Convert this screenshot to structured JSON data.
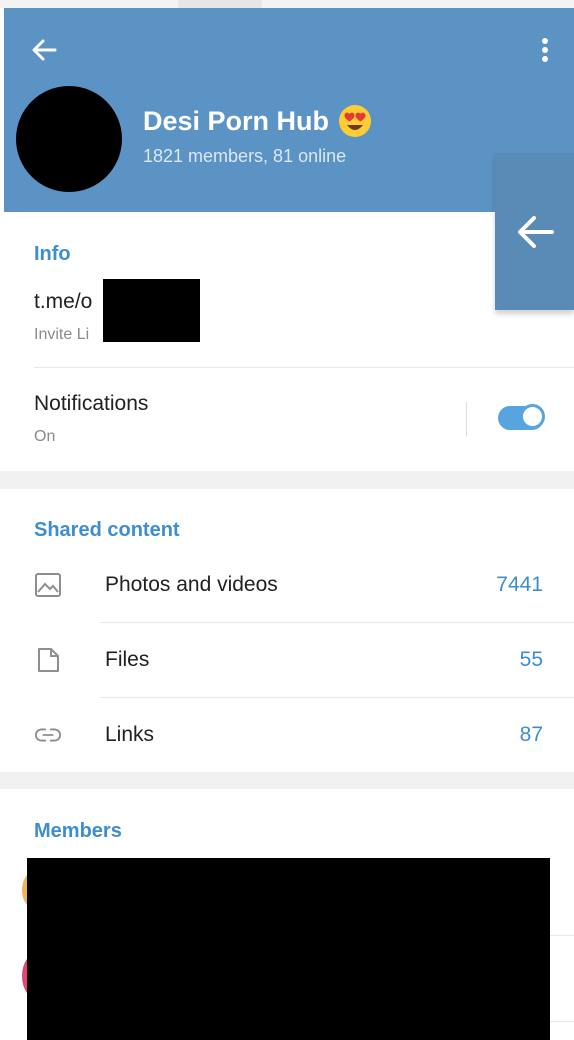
{
  "header": {
    "title": "Desi Porn Hub",
    "subtitle": "1821 members, 81 online"
  },
  "info": {
    "section_title": "Info",
    "link_prefix": "t.me/o",
    "link_label": "Invite Li"
  },
  "notifications": {
    "title": "Notifications",
    "status": "On",
    "enabled": true
  },
  "shared_content": {
    "section_title": "Shared content",
    "items": [
      {
        "label": "Photos and videos",
        "count": "7441",
        "icon": "image-icon"
      },
      {
        "label": "Files",
        "count": "55",
        "icon": "file-icon"
      },
      {
        "label": "Links",
        "count": "87",
        "icon": "link-icon"
      }
    ]
  },
  "members": {
    "section_title": "Members"
  },
  "colors": {
    "header": "#5b93c4",
    "accent": "#3d8ed0",
    "toggle": "#58a4de"
  }
}
